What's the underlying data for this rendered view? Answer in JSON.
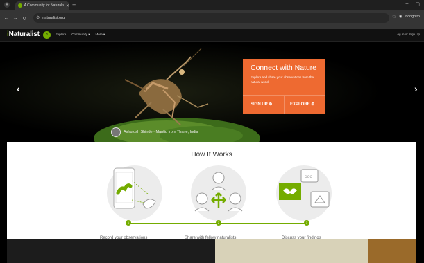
{
  "browser": {
    "tab_title": "A Community for Naturalis",
    "url": "inaturalist.org",
    "incognito_label": "Incognito"
  },
  "site": {
    "logo_prefix": "i",
    "logo_main": "Naturalist",
    "nav": [
      "Explore",
      "Community ▾",
      "More ▾"
    ],
    "login": "Log In or Sign Up"
  },
  "hero": {
    "cta_title": "Connect with Nature",
    "cta_subtitle": "Explore and share your observations from the natural world.",
    "signup_label": "SIGN UP ⊕",
    "explore_label": "EXPLORE ⊕",
    "credit": "Ashutosh Shinde  ·  Mantid from Thane, India",
    "prev_arrow": "‹",
    "next_arrow": "›"
  },
  "how_it_works": {
    "title": "How It Works",
    "steps": [
      {
        "number": "1",
        "label": "Record your observations"
      },
      {
        "number": "2",
        "label": "Share with fellow naturalists"
      },
      {
        "number": "3",
        "label": "Discuss your findings"
      }
    ]
  },
  "colors": {
    "brand_green": "#74ac00",
    "cta_orange": "#ee6a31"
  }
}
